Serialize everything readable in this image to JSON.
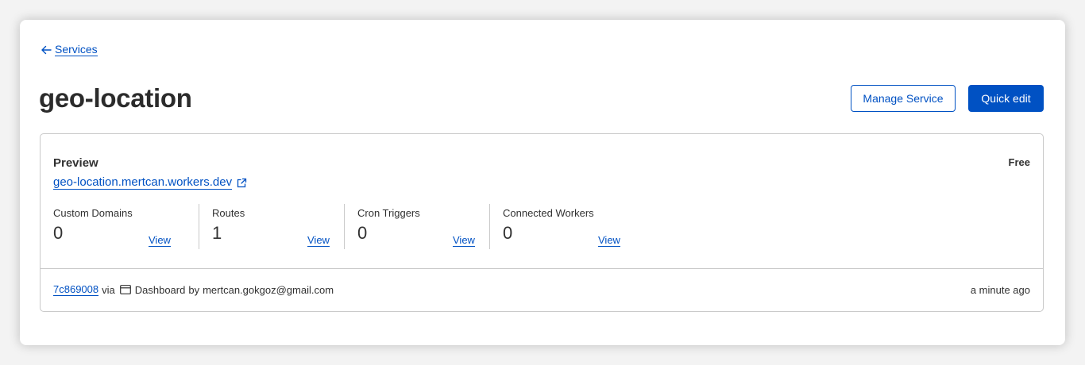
{
  "breadcrumb": {
    "back_label": "Services"
  },
  "header": {
    "title": "geo-location",
    "manage_label": "Manage Service",
    "quick_edit_label": "Quick edit"
  },
  "preview": {
    "heading": "Preview",
    "url": "geo-location.mertcan.workers.dev",
    "plan": "Free"
  },
  "stats": [
    {
      "label": "Custom Domains",
      "value": "0",
      "action": "View"
    },
    {
      "label": "Routes",
      "value": "1",
      "action": "View"
    },
    {
      "label": "Cron Triggers",
      "value": "0",
      "action": "View"
    },
    {
      "label": "Connected Workers",
      "value": "0",
      "action": "View"
    }
  ],
  "deployment": {
    "commit": "7c869008",
    "via": "via",
    "source": "Dashboard",
    "by": "by",
    "author": "mertcan.gokgoz@gmail.com",
    "time": "a minute ago"
  },
  "icons": {
    "back": "arrow-left-icon",
    "external": "external-link-icon",
    "dashboard": "browser-window-icon"
  },
  "colors": {
    "accent": "#0051c3",
    "border": "#c9c9c9",
    "text": "#313131"
  }
}
